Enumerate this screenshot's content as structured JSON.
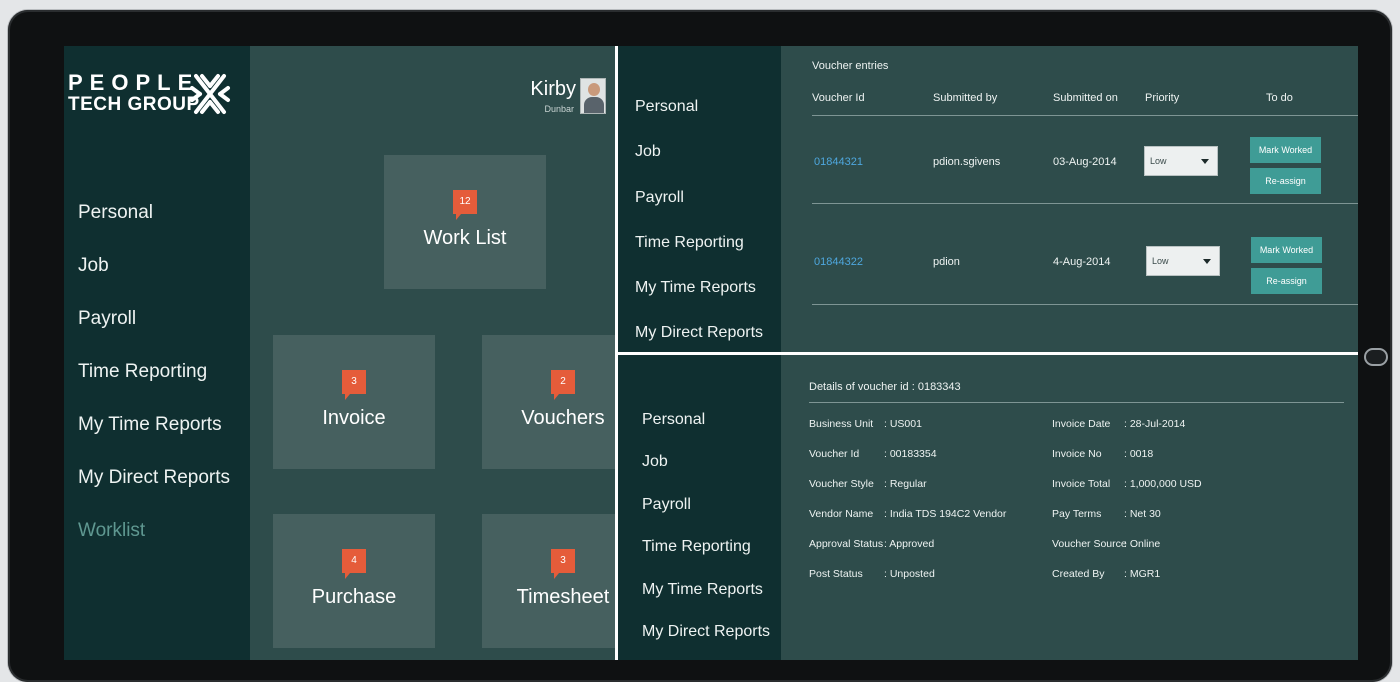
{
  "brand": {
    "line1": "PEOPLE",
    "line2": "TECH GROUP"
  },
  "user": {
    "name": "Kirby",
    "subtitle": "Dunbar"
  },
  "main_nav": [
    "Personal",
    "Job",
    "Payroll",
    "Time Reporting",
    "My Time Reports",
    "My Direct Reports",
    "Worklist"
  ],
  "tiles": [
    {
      "label": "Work List",
      "badge": "12"
    },
    {
      "label": "Invoice",
      "badge": "3"
    },
    {
      "label": "Vouchers",
      "badge": "2"
    },
    {
      "label": "Purchase",
      "badge": "4"
    },
    {
      "label": "Timesheet",
      "badge": "3"
    }
  ],
  "side_nav": [
    "Personal",
    "Job",
    "Payroll",
    "Time Reporting",
    "My Time Reports",
    "My Direct Reports"
  ],
  "vouchers": {
    "title": "Voucher entries",
    "columns": [
      "Voucher Id",
      "Submitted by",
      "Submitted on",
      "Priority",
      "To do"
    ],
    "rows": [
      {
        "id": "01844321",
        "submitted_by": "pdion.sgivens",
        "submitted_on": "03-Aug-2014",
        "priority": "Low"
      },
      {
        "id": "01844322",
        "submitted_by": "pdion",
        "submitted_on": "4-Aug-2014",
        "priority": "Low"
      }
    ],
    "actions": {
      "mark": "Mark Worked",
      "reassign": "Re-assign"
    }
  },
  "details": {
    "title": "Details of voucher id : 0183343",
    "left": [
      {
        "label": "Business Unit",
        "value": ": US001"
      },
      {
        "label": "Voucher Id",
        "value": ": 00183354"
      },
      {
        "label": "Voucher Style",
        "value": ": Regular"
      },
      {
        "label": "Vendor Name",
        "value": ": India TDS 194C2 Vendor"
      },
      {
        "label": "Approval Status",
        "value": ": Approved"
      },
      {
        "label": "Post Status",
        "value": ": Unposted"
      }
    ],
    "right": [
      {
        "label": "Invoice Date",
        "value": ": 28-Jul-2014"
      },
      {
        "label": "Invoice No",
        "value": ": 0018"
      },
      {
        "label": "Invoice Total",
        "value": ": 1,000,000  USD"
      },
      {
        "label": "Pay Terms",
        "value": ": Net 30"
      },
      {
        "label": "Voucher Source",
        "value": ": Online"
      },
      {
        "label": "Created By",
        "value": ": MGR1"
      }
    ]
  },
  "colors": {
    "nav_bg": "#0f2f30",
    "panel_bg": "#2e4c4b",
    "tile_bg": "#46605f",
    "badge": "#e55c3a",
    "button": "#3f9c96",
    "link": "#4ea7de",
    "muted_nav": "#5f9891"
  }
}
